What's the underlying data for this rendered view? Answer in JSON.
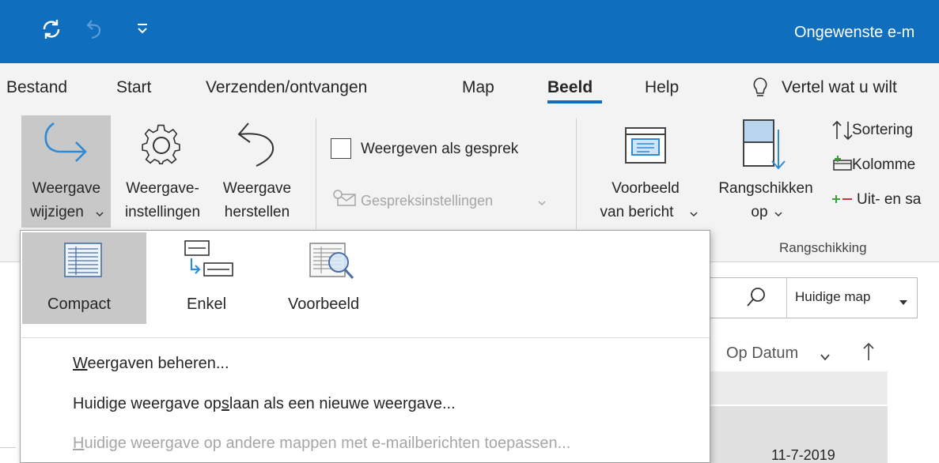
{
  "window": {
    "title": "Ongewenste e-m"
  },
  "tabs": [
    {
      "label": "Bestand"
    },
    {
      "label": "Start"
    },
    {
      "label": "Verzenden/ontvangen"
    },
    {
      "label": "Map"
    },
    {
      "label": "Beeld",
      "active": true
    },
    {
      "label": "Help"
    }
  ],
  "tell_me": {
    "placeholder": "Vertel wat u wilt"
  },
  "ribbon": {
    "view_change": {
      "line1": "Weergave",
      "line2": "wijzigen"
    },
    "view_settings": {
      "line1": "Weergave-",
      "line2": "instellingen"
    },
    "view_reset": {
      "line1": "Weergave",
      "line2": "herstellen"
    },
    "show_as_conversation": "Weergeven als gesprek",
    "conversation_settings": "Gespreksinstellingen",
    "reading_preview": {
      "line1": "Voorbeeld",
      "line2": "van bericht"
    },
    "arrange_by": {
      "line1": "Rangschikken",
      "line2": "op"
    },
    "sort": "Sortering",
    "columns": "Kolomme",
    "expand_collapse": "Uit- en sa",
    "group_arrangement": "Rangschikking"
  },
  "search": {
    "scope": "Huidige map"
  },
  "list": {
    "sort_label": "Op Datum",
    "date": "11-7-2019"
  },
  "dropdown": {
    "views": [
      {
        "label": "Compact",
        "selected": true
      },
      {
        "label": "Enkel"
      },
      {
        "label": "Voorbeeld"
      }
    ],
    "menu": {
      "manage": {
        "accel": "W",
        "rest": "eergaven beheren..."
      },
      "save": {
        "pre": "Huidige weergave op",
        "accel": "s",
        "post": "laan als een nieuwe weergave..."
      },
      "apply": {
        "accel": "H",
        "rest": "uidige weergave op andere mappen met e-mailberichten toepassen..."
      }
    }
  },
  "colors": {
    "titlebar": "#106ebe",
    "ribbon": "#f3f3f3",
    "selected": "#c8c8c8",
    "accent_icon": "#2e8bd6",
    "disabled_text": "#a6a6a6"
  }
}
